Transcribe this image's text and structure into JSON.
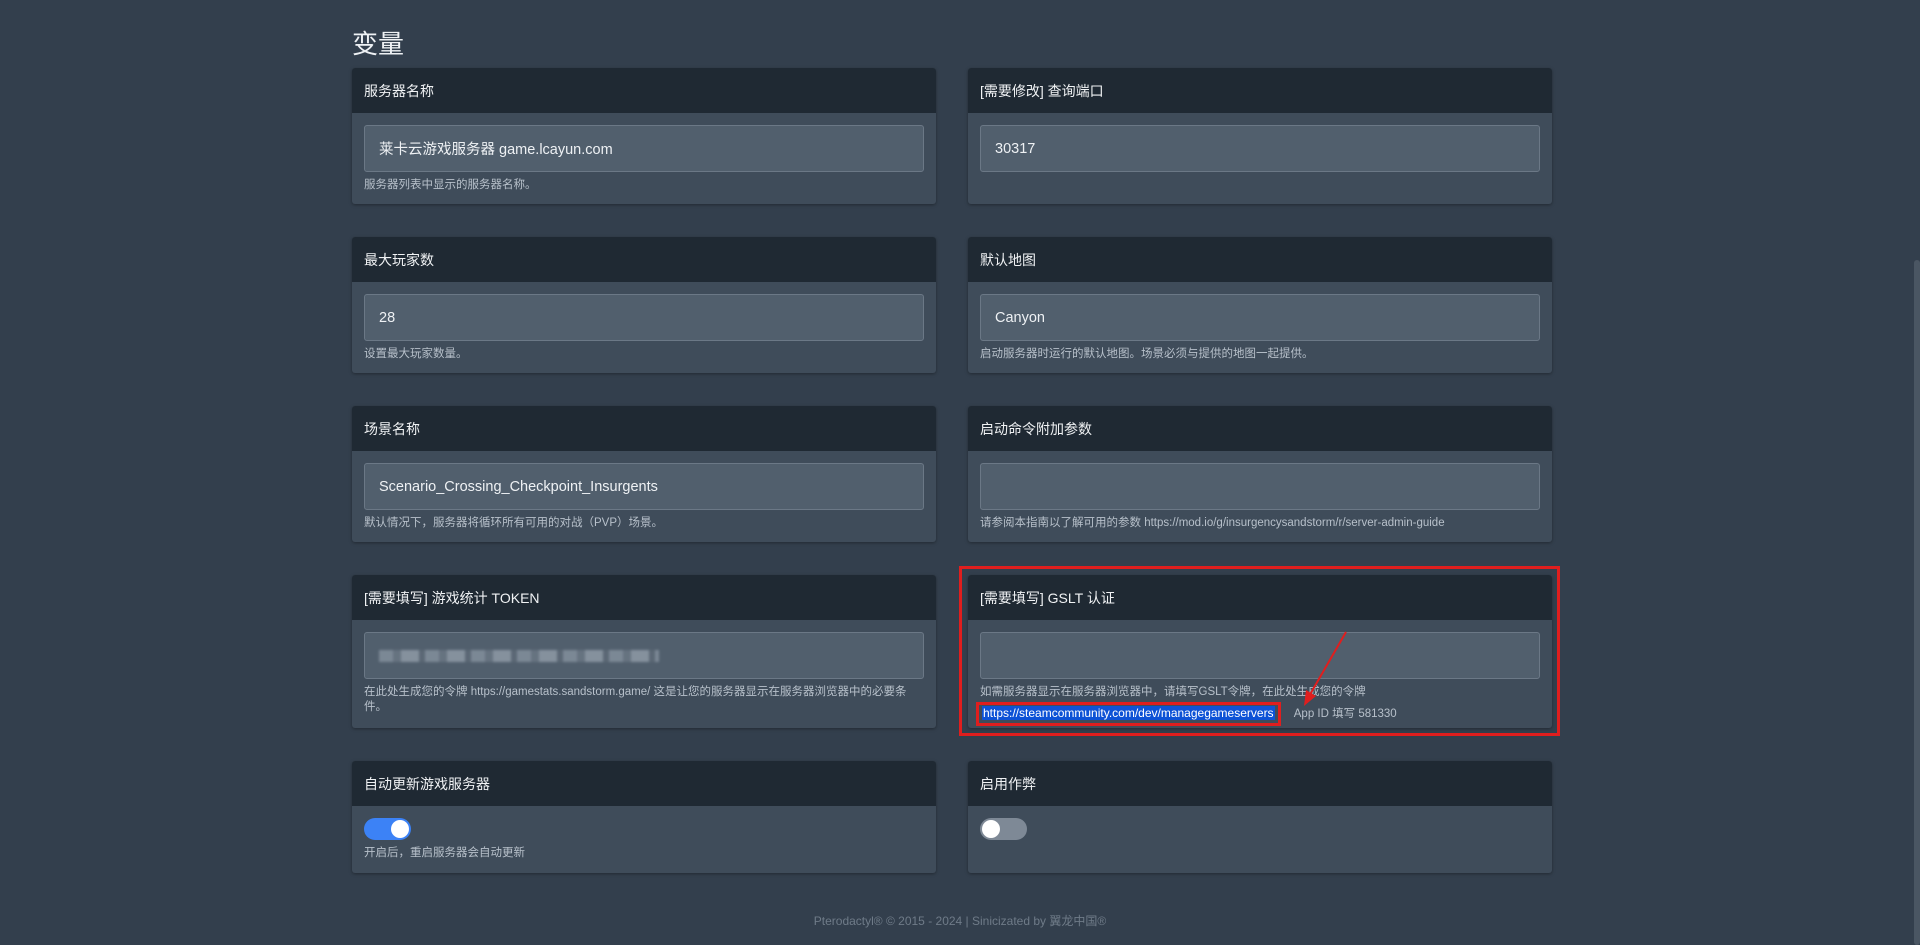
{
  "section": {
    "title": "变量"
  },
  "cards": {
    "server_name": {
      "label": "服务器名称",
      "value": "莱卡云游戏服务器 game.lcayun.com",
      "help": "服务器列表中显示的服务器名称。"
    },
    "query_port": {
      "label": "[需要修改] 查询端口",
      "value": "30317"
    },
    "max_players": {
      "label": "最大玩家数",
      "value": "28",
      "help": "设置最大玩家数量。"
    },
    "default_map": {
      "label": "默认地图",
      "value": "Canyon",
      "help": "启动服务器时运行的默认地图。场景必须与提供的地图一起提供。"
    },
    "scenario": {
      "label": "场景名称",
      "value": "Scenario_Crossing_Checkpoint_Insurgents",
      "help": "默认情况下，服务器将循环所有可用的对战（PVP）场景。"
    },
    "launch_args": {
      "label": "启动命令附加参数",
      "value": "",
      "help": "请参阅本指南以了解可用的参数 https://mod.io/g/insurgencysandstorm/r/server-admin-guide"
    },
    "stats_token": {
      "label": "[需要填写] 游戏统计 TOKEN",
      "help": "在此处生成您的令牌 https://gamestats.sandstorm.game/ 这是让您的服务器显示在服务器浏览器中的必要条件。"
    },
    "gslt": {
      "label": "[需要填写] GSLT 认证",
      "value": "",
      "help": "如需服务器显示在服务器浏览器中，请填写GSLT令牌，在此处生成您的令牌",
      "link": "https://steamcommunity.com/dev/managegameservers",
      "appid": "App ID 填写 581330"
    },
    "auto_update": {
      "label": "自动更新游戏服务器",
      "enabled": true,
      "help": "开启后，重启服务器会自动更新"
    },
    "cheats": {
      "label": "启用作弊",
      "enabled": false
    }
  },
  "footer": {
    "text": "Pterodactyl® © 2015 - 2024 | Sinicizated by 翼龙中国®"
  },
  "colors": {
    "background": "#333f4d",
    "card": "#3f4c5a",
    "card_header": "#1f2933",
    "accent": "#3c82f6",
    "highlight": "#e01e1e"
  }
}
